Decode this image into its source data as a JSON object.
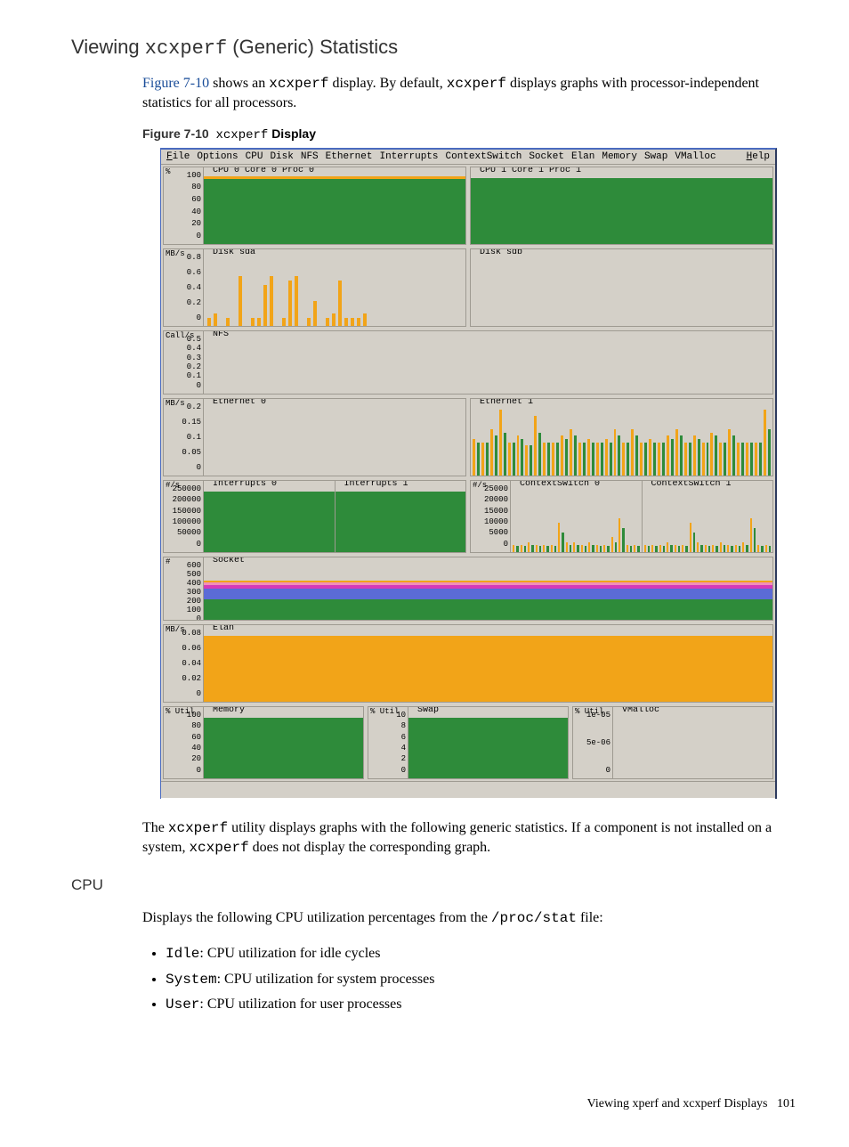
{
  "heading": {
    "prefix": "Viewing ",
    "code": "xcxperf",
    "suffix": " (Generic) Statistics"
  },
  "intro": {
    "link": "Figure 7-10",
    "t1": " shows an ",
    "code1": "xcxperf",
    "t2": " display. By default, ",
    "code2": "xcxperf",
    "t3": " displays graphs with processor-independent statistics for all processors."
  },
  "fig_caption": {
    "num": "Figure 7-10",
    "code": "xcxperf",
    "suffix": " Display"
  },
  "menu": [
    "File",
    "Options",
    "CPU",
    "Disk",
    "NFS",
    "Ethernet",
    "Interrupts",
    "ContextSwitch",
    "Socket",
    "Elan",
    "Memory",
    "Swap",
    "VMalloc",
    "Help"
  ],
  "panels": {
    "cpu0": {
      "ylabel": "%",
      "yticks": [
        "100",
        "80",
        "60",
        "40",
        "20",
        "0"
      ],
      "legend": "CPU 0 Core 0 Proc 0"
    },
    "cpu1": {
      "legend": "CPU 1 Core 1 Proc 1"
    },
    "disk0": {
      "ylabel": "MB/s",
      "yticks": [
        "0.8",
        "0.6",
        "0.4",
        "0.2",
        "0"
      ],
      "legend": "Disk sda"
    },
    "disk1": {
      "legend": "Disk sdb"
    },
    "nfs": {
      "ylabel": "Call/s",
      "yticks": [
        "0.5",
        "0.4",
        "0.3",
        "0.2",
        "0.1",
        "0"
      ],
      "legend": "NFS"
    },
    "eth0": {
      "ylabel": "MB/s",
      "yticks": [
        "0.2",
        "0.15",
        "0.1",
        "0.05",
        "0"
      ],
      "legend": "Ethernet 0"
    },
    "eth1": {
      "legend": "Ethernet 1"
    },
    "intr0": {
      "ylabel": "#/s",
      "yticks": [
        "250000",
        "200000",
        "150000",
        "100000",
        "50000",
        "0"
      ],
      "legend": "Interrupts 0"
    },
    "intr1": {
      "legend": "Interrupts 1"
    },
    "csw0": {
      "ylabel": "#/s",
      "yticks": [
        "25000",
        "20000",
        "15000",
        "10000",
        "5000",
        "0"
      ],
      "legend": "ContextSwitch 0"
    },
    "csw1": {
      "legend": "ContextSwitch 1"
    },
    "socket": {
      "ylabel": "#",
      "yticks": [
        "600",
        "500",
        "400",
        "300",
        "200",
        "100",
        "0"
      ],
      "legend": "Socket"
    },
    "elan": {
      "ylabel": "MB/s",
      "yticks": [
        "0.08",
        "0.06",
        "0.04",
        "0.02",
        "0"
      ],
      "legend": "Elan"
    },
    "mem": {
      "ylabel": "% Util",
      "yticks": [
        "100",
        "80",
        "60",
        "40",
        "20",
        "0"
      ],
      "legend": "Memory"
    },
    "swap": {
      "ylabel": "% Util",
      "yticks": [
        "10",
        "8",
        "6",
        "4",
        "2",
        "0"
      ],
      "legend": "Swap"
    },
    "vmalloc": {
      "ylabel": "% Util",
      "yticks": [
        "1e-05",
        "5e-06",
        "0"
      ],
      "legend": "VMalloc"
    }
  },
  "chart_data": [
    {
      "type": "area",
      "title": "CPU 0 Core 0 Proc 0",
      "ylabel": "%",
      "ylim": [
        0,
        100
      ],
      "note": "near-100% green fill with small orange spikes at top"
    },
    {
      "type": "area",
      "title": "CPU 1 Core 1 Proc 1",
      "ylabel": "%",
      "ylim": [
        0,
        100
      ],
      "note": "near-100% green fill"
    },
    {
      "type": "bar",
      "title": "Disk sda",
      "ylabel": "MB/s",
      "ylim": [
        0,
        0.8
      ],
      "values": [
        0.1,
        0.15,
        0,
        0.1,
        0,
        0.6,
        0,
        0.1,
        0.1,
        0.5,
        0.6,
        0,
        0.1,
        0.55,
        0.6,
        0,
        0.1,
        0.3,
        0,
        0.1,
        0.15,
        0.55,
        0.1,
        0.1,
        0.1,
        0.15
      ]
    },
    {
      "type": "bar",
      "title": "Disk sdb",
      "ylabel": "MB/s",
      "ylim": [
        0,
        0.8
      ],
      "values": []
    },
    {
      "type": "bar",
      "title": "NFS",
      "ylabel": "Call/s",
      "ylim": [
        0,
        0.5
      ],
      "values": []
    },
    {
      "type": "bar",
      "title": "Ethernet 0",
      "ylabel": "MB/s",
      "ylim": [
        0,
        0.2
      ],
      "values": []
    },
    {
      "type": "bar",
      "title": "Ethernet 1",
      "ylabel": "MB/s",
      "ylim": [
        0,
        0.2
      ],
      "series": [
        {
          "name": "orange",
          "values": [
            0.11,
            0.1,
            0.14,
            0.2,
            0.1,
            0.12,
            0.09,
            0.18,
            0.1,
            0.1,
            0.12,
            0.14,
            0.1,
            0.11,
            0.1,
            0.11,
            0.14,
            0.1,
            0.14,
            0.1,
            0.11,
            0.1,
            0.12,
            0.14,
            0.1,
            0.12,
            0.1,
            0.13,
            0.1,
            0.14,
            0.1,
            0.1,
            0.1,
            0.2
          ]
        },
        {
          "name": "green",
          "values": [
            0.1,
            0.1,
            0.12,
            0.13,
            0.1,
            0.11,
            0.09,
            0.13,
            0.1,
            0.1,
            0.11,
            0.12,
            0.1,
            0.1,
            0.1,
            0.1,
            0.12,
            0.1,
            0.12,
            0.1,
            0.1,
            0.1,
            0.11,
            0.12,
            0.1,
            0.11,
            0.1,
            0.12,
            0.1,
            0.12,
            0.1,
            0.1,
            0.1,
            0.14
          ]
        }
      ]
    },
    {
      "type": "area",
      "title": "Interrupts 0",
      "ylabel": "#/s",
      "ylim": [
        0,
        250000
      ],
      "note": "solid green ~100% fill"
    },
    {
      "type": "area",
      "title": "Interrupts 1",
      "ylabel": "#/s",
      "ylim": [
        0,
        250000
      ],
      "note": "solid green ~100% fill"
    },
    {
      "type": "bar",
      "title": "ContextSwitch 0",
      "ylabel": "#/s",
      "ylim": [
        0,
        25000
      ],
      "series": [
        {
          "name": "orange",
          "values": [
            3000,
            3000,
            4000,
            3000,
            3000,
            3000,
            12000,
            4000,
            4000,
            3000,
            4000,
            3000,
            3000,
            6000,
            14000,
            3000,
            3000
          ]
        },
        {
          "name": "green",
          "values": [
            2500,
            2500,
            3000,
            2500,
            2500,
            2500,
            8000,
            3000,
            3000,
            2500,
            3000,
            2500,
            2500,
            4000,
            10000,
            2500,
            2500
          ]
        }
      ]
    },
    {
      "type": "bar",
      "title": "ContextSwitch 1",
      "ylabel": "#/s",
      "ylim": [
        0,
        25000
      ],
      "series": [
        {
          "name": "orange",
          "values": [
            3000,
            3000,
            3000,
            4000,
            3000,
            3000,
            12000,
            4000,
            3000,
            3000,
            4000,
            3000,
            3000,
            4000,
            14000,
            3000,
            3000
          ]
        },
        {
          "name": "green",
          "values": [
            2500,
            2500,
            2500,
            3000,
            2500,
            2500,
            8000,
            3000,
            2500,
            2500,
            3000,
            2500,
            2500,
            3000,
            10000,
            2500,
            2500
          ]
        }
      ]
    },
    {
      "type": "area",
      "title": "Socket",
      "ylabel": "#",
      "ylim": [
        0,
        600
      ],
      "bands": [
        {
          "name": "green",
          "from": 0,
          "to": 200,
          "color": "#2e8b3a"
        },
        {
          "name": "blue",
          "from": 200,
          "to": 300,
          "color": "#5b6bd6"
        },
        {
          "name": "magenta",
          "from": 300,
          "to": 330,
          "color": "#d63ab8"
        },
        {
          "name": "pink",
          "from": 330,
          "to": 345,
          "color": "#f28fb8"
        },
        {
          "name": "orange",
          "from": 345,
          "to": 360,
          "color": "#f2a418"
        }
      ],
      "note": "stacked bands with slight bulge mid-chart"
    },
    {
      "type": "area",
      "title": "Elan",
      "ylabel": "MB/s",
      "ylim": [
        0,
        0.08
      ],
      "note": "solid orange full fill"
    },
    {
      "type": "area",
      "title": "Memory",
      "ylabel": "% Util",
      "ylim": [
        0,
        100
      ],
      "note": "solid green full fill"
    },
    {
      "type": "area",
      "title": "Swap",
      "ylabel": "% Util",
      "ylim": [
        0,
        10
      ],
      "note": "solid green full fill"
    },
    {
      "type": "area",
      "title": "VMalloc",
      "ylabel": "% Util",
      "ylim": [
        0,
        1e-05
      ],
      "note": "empty"
    }
  ],
  "post_fig": {
    "t1": "The ",
    "code1": "xcxperf",
    "t2": " utility displays graphs with the following generic statistics. If a component is not installed on a system, ",
    "code2": "xcxperf",
    "t3": " does not display the corresponding graph."
  },
  "cpu_heading": "CPU",
  "cpu_intro": {
    "t1": "Displays the following CPU utilization percentages from the ",
    "code": "/proc/stat",
    "t2": " file:"
  },
  "bullets": {
    "idle": {
      "code": "Idle",
      "text": ": CPU utilization for idle cycles"
    },
    "system": {
      "code": "System",
      "text": ": CPU utilization for system processes"
    },
    "user": {
      "code": "User",
      "text": ": CPU utilization for user processes"
    }
  },
  "footer": {
    "text": "Viewing xperf and xcxperf Displays",
    "page": "101"
  }
}
